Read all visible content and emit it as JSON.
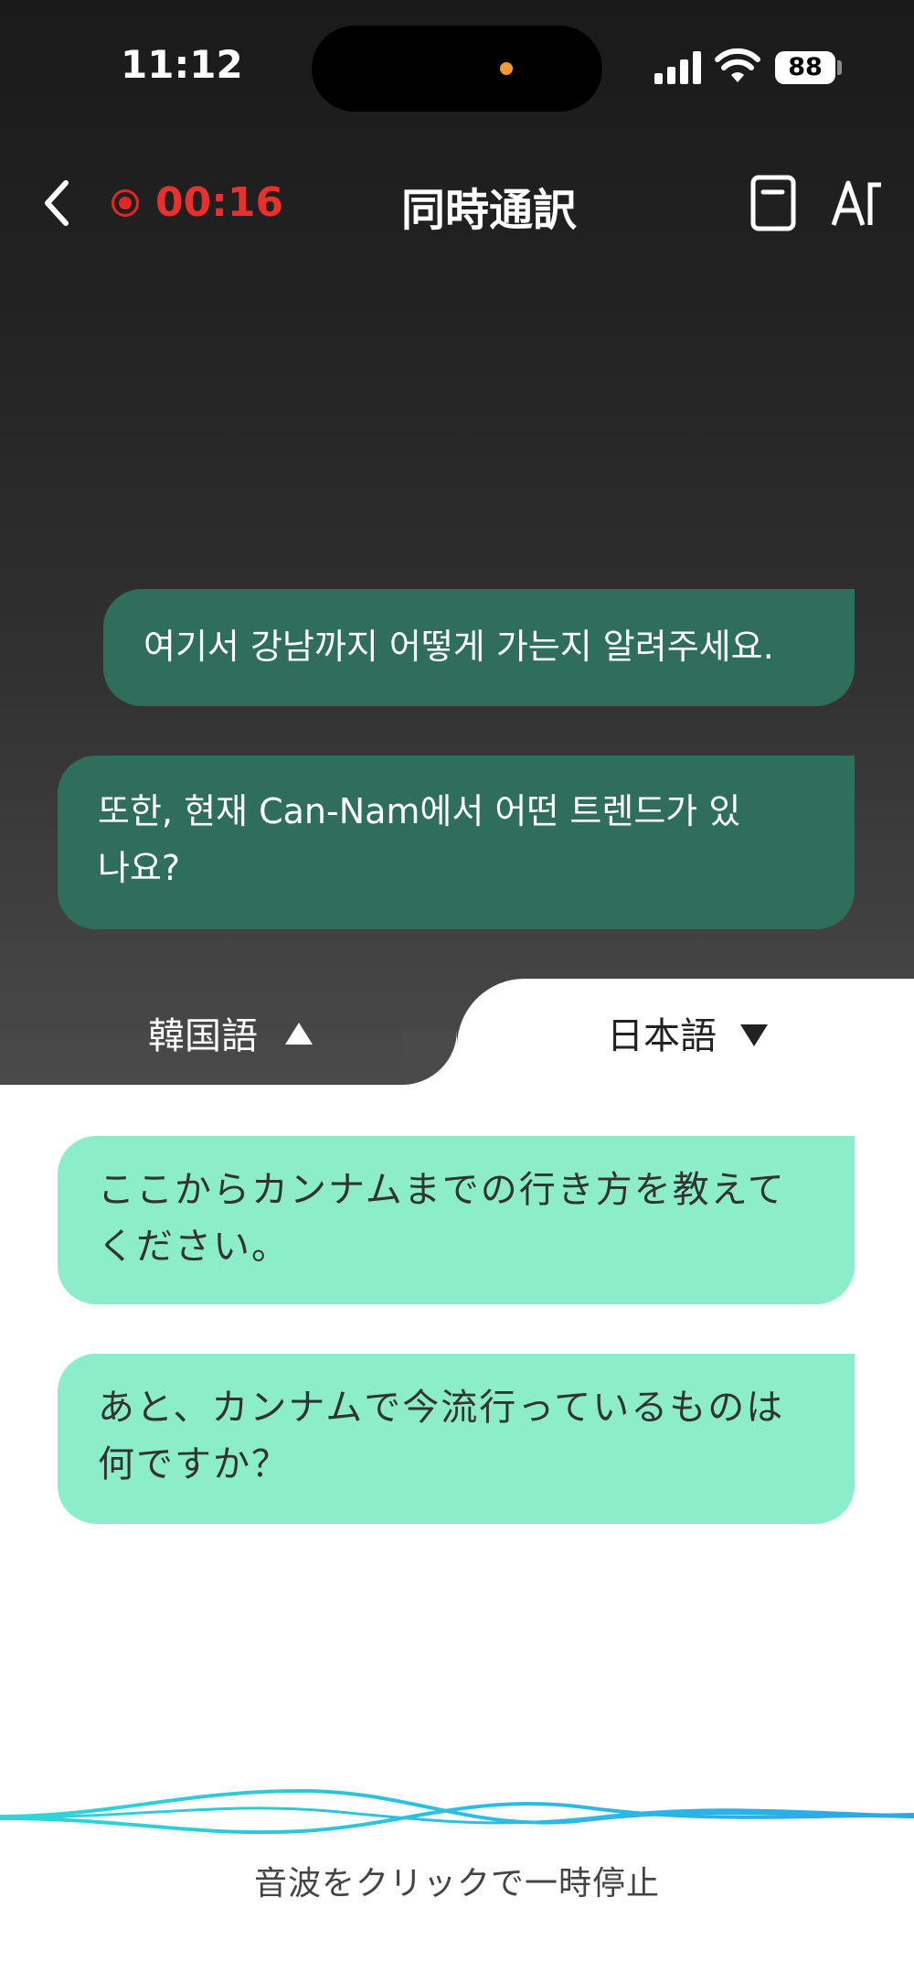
{
  "status_bar": {
    "time": "11:12",
    "battery": "88"
  },
  "header": {
    "recording_time": "00:16",
    "title": "同時通訳"
  },
  "source_messages": [
    {
      "lines": [
        "여기서 강남까지 어떻게 가는지 알려주세요."
      ]
    },
    {
      "lines": [
        "또한, 현재 Can-Nam에서 어떤 트렌드가 있",
        "나요?"
      ]
    }
  ],
  "languages": {
    "source": "韓国語",
    "target": "日本語"
  },
  "translated_messages": [
    {
      "lines": [
        "ここからカンナムまでの行き方を教えて",
        "ください。"
      ]
    },
    {
      "lines": [
        "あと、カンナムで今流行っているものは",
        "何ですか？"
      ]
    }
  ],
  "footer": {
    "hint": "音波をクリックで一時停止"
  },
  "colors": {
    "record_red": "#e8302c",
    "source_bubble": "#2e6e5a",
    "target_bubble": "#8cedcb",
    "wave": "#22c4e0"
  }
}
